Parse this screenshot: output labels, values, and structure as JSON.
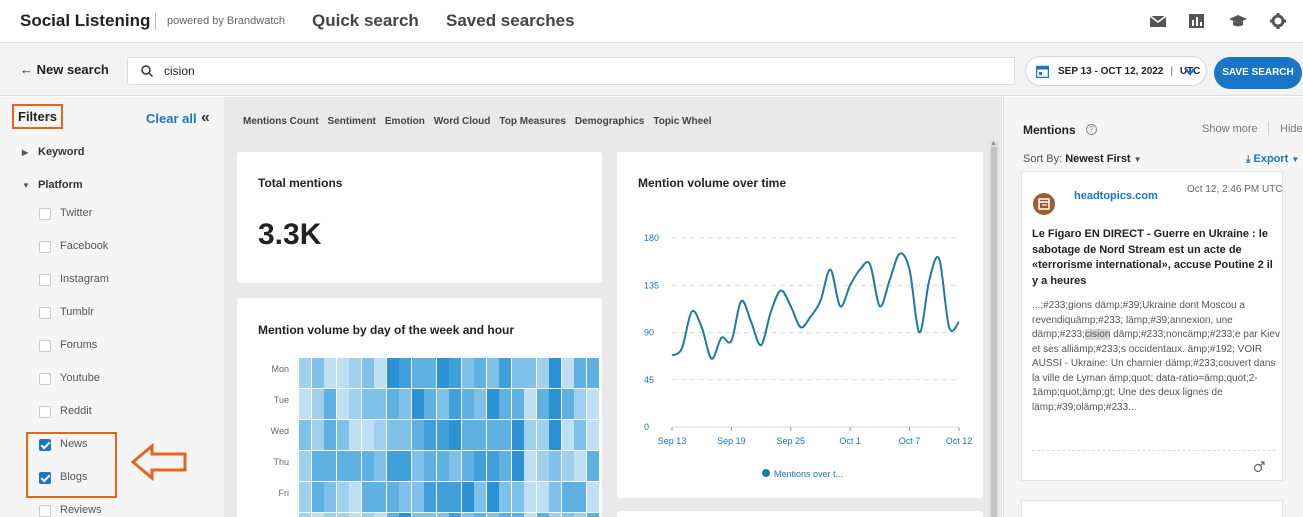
{
  "header": {
    "brand": "Social Listening",
    "powered_by": "powered by Brandwatch",
    "nav": [
      "Quick search",
      "Saved searches"
    ],
    "icons": [
      "mail-icon",
      "chart-icon",
      "graduation-cap-icon",
      "gear-icon"
    ]
  },
  "search": {
    "new_search": "← New search",
    "query": "cision",
    "date_range": "SEP 13 - OCT 12, 2022",
    "timezone": "UTC",
    "save_label": "SAVE SEARCH"
  },
  "filters": {
    "title": "Filters",
    "clear_all": "Clear all",
    "collapse": "«",
    "keyword": "Keyword",
    "platform": "Platform",
    "platforms": [
      {
        "label": "Twitter",
        "checked": false
      },
      {
        "label": "Facebook",
        "checked": false
      },
      {
        "label": "Instagram",
        "checked": false
      },
      {
        "label": "Tumblr",
        "checked": false
      },
      {
        "label": "Forums",
        "checked": false
      },
      {
        "label": "Youtube",
        "checked": false
      },
      {
        "label": "Reddit",
        "checked": false
      },
      {
        "label": "News",
        "checked": true
      },
      {
        "label": "Blogs",
        "checked": true
      },
      {
        "label": "Reviews",
        "checked": false
      }
    ]
  },
  "tabs": [
    "Mentions Count",
    "Sentiment",
    "Emotion",
    "Word Cloud",
    "Top Measures",
    "Demographics",
    "Topic Wheel"
  ],
  "total_mentions": {
    "title": "Total mentions",
    "value": "3.3K"
  },
  "heatmap": {
    "title": "Mention volume by day of the week and hour",
    "days": [
      "Mon",
      "Tue",
      "Wed",
      "Thu",
      "Fri"
    ]
  },
  "chart_data": {
    "type": "line",
    "title": "Mention volume over time",
    "x": [
      "Sep 13",
      "Sep 14",
      "Sep 15",
      "Sep 16",
      "Sep 17",
      "Sep 18",
      "Sep 19",
      "Sep 20",
      "Sep 21",
      "Sep 22",
      "Sep 23",
      "Sep 24",
      "Sep 25",
      "Sep 26",
      "Sep 27",
      "Sep 28",
      "Sep 29",
      "Sep 30",
      "Oct 1",
      "Oct 2",
      "Oct 3",
      "Oct 4",
      "Oct 5",
      "Oct 6",
      "Oct 7",
      "Oct 8",
      "Oct 9",
      "Oct 10",
      "Oct 11",
      "Oct 12"
    ],
    "x_ticks": [
      "Sep 13",
      "Sep 19",
      "Sep 25",
      "Oct 1",
      "Oct 7",
      "Oct 12"
    ],
    "series": [
      {
        "name": "Mentions over t...",
        "values": [
          68,
          75,
          110,
          95,
          65,
          85,
          82,
          120,
          100,
          78,
          110,
          130,
          115,
          95,
          105,
          120,
          150,
          115,
          135,
          150,
          155,
          115,
          140,
          165,
          150,
          90,
          140,
          160,
          95,
          100
        ]
      }
    ],
    "ylim": [
      0,
      180
    ],
    "y_ticks": [
      0,
      45,
      90,
      135,
      180
    ],
    "grid": true,
    "legend": "bottom",
    "color": "#1b7aa6"
  },
  "mentions": {
    "title": "Mentions",
    "show_more": "Show more",
    "hide": "Hide",
    "sort_prefix": "Sort By:",
    "sort_value": "Newest First",
    "export": "Export",
    "card": {
      "source": "headtopics.com",
      "date": "Oct 12, 2:46 PM UTC",
      "headline": "Le Figaro EN DIRECT - Guerre en Ukraine : le sabotage de Nord Stream est un acte de «terrorisme international», accuse Poutine 2 il y a heures",
      "snippet_before": "...;#233;gions dämp;#39;Ukraine dont Moscou a revendiquämp;#233; lämp;#39;annexion, une dämp;#233;",
      "snippet_highlight": "cision",
      "snippet_after": " dämp;#233;noncämp;#233;e par Kiev et ses alliämp;#233;s occidentaux. ämp;#192; VOIR AUSSI - Ukraine: Un charnier dämp;#233;couvert dans la ville de Lyman ämp;quot; data-ratio=ämp;quot;2-1ämp;quot;ämp;gt; Une des deux lignes de lämp;#39;olämp;#233..."
    }
  }
}
